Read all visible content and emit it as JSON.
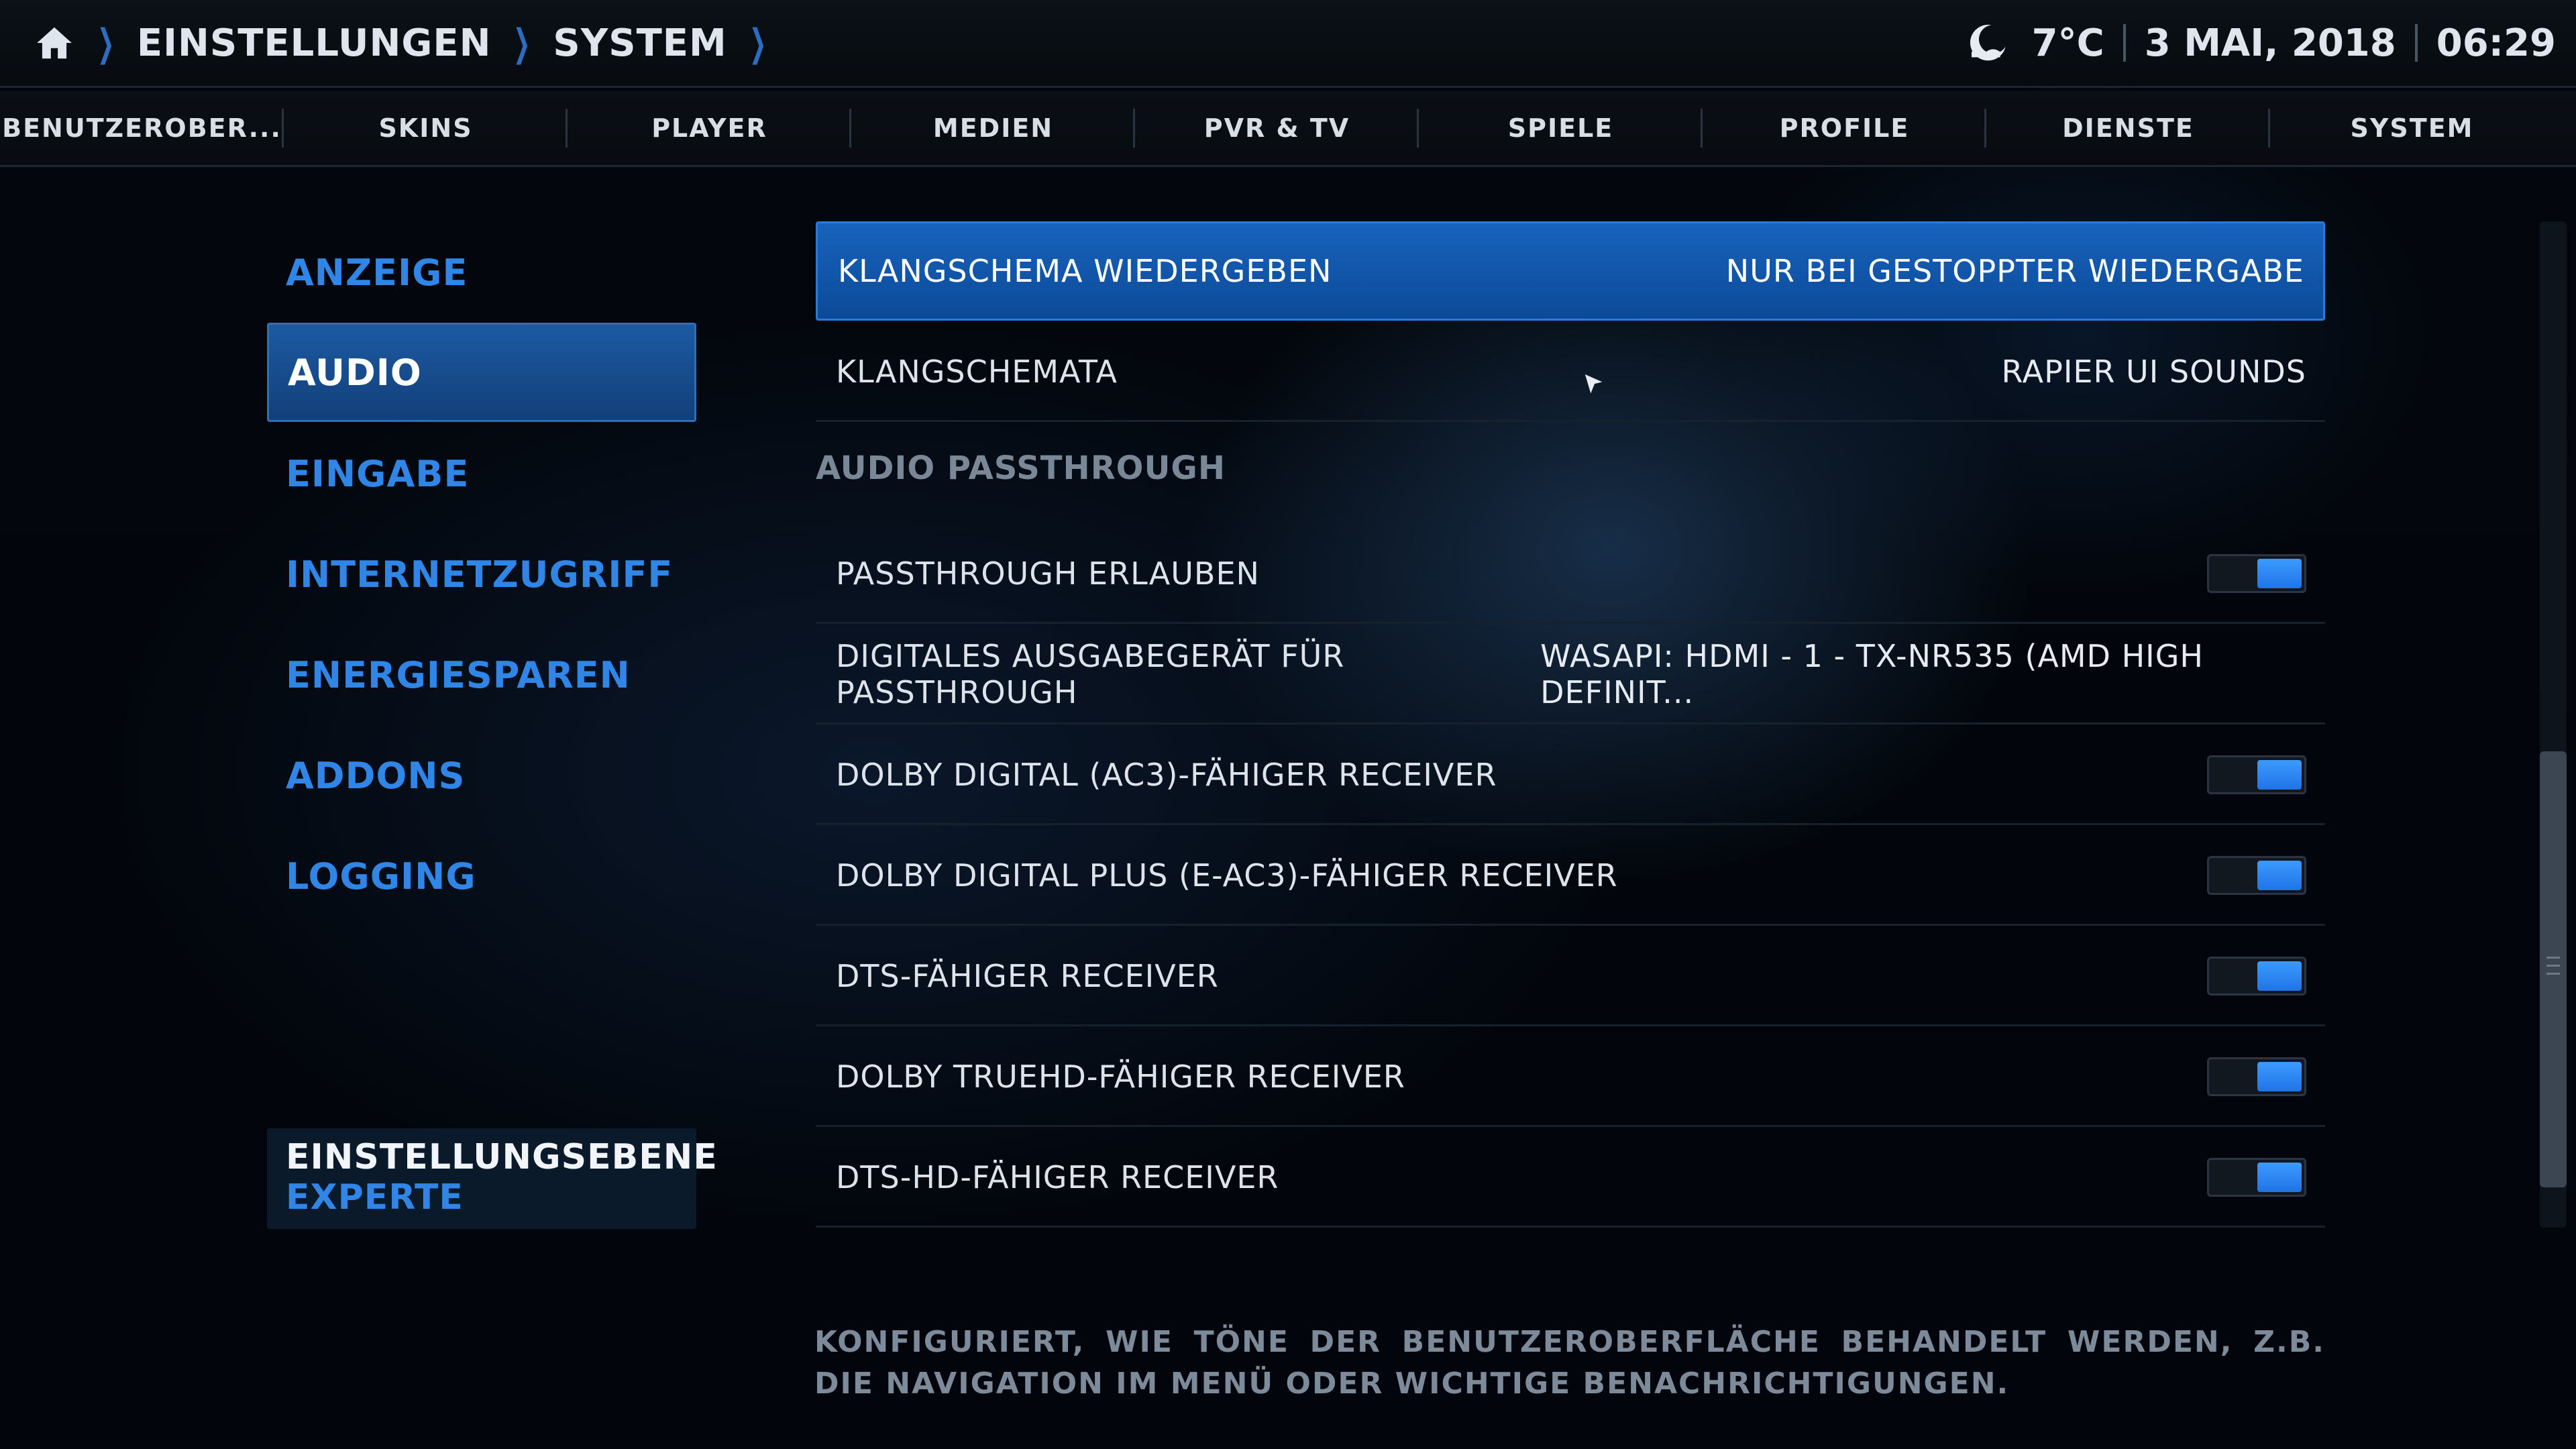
{
  "header": {
    "breadcrumbs": [
      "EINSTELLUNGEN",
      "SYSTEM"
    ],
    "weather_icon": "moon-icon",
    "temperature": "7°C",
    "date": "3 MAI, 2018",
    "time": "06:29"
  },
  "tabs": [
    "BENUTZEROBER...",
    "SKINS",
    "PLAYER",
    "MEDIEN",
    "PVR & TV",
    "SPIELE",
    "PROFILE",
    "DIENSTE",
    "SYSTEM"
  ],
  "sidebar": {
    "items": [
      {
        "label": "ANZEIGE",
        "active": false
      },
      {
        "label": "AUDIO",
        "active": true
      },
      {
        "label": "EINGABE",
        "active": false
      },
      {
        "label": "INTERNETZUGRIFF",
        "active": false
      },
      {
        "label": "ENERGIESPAREN",
        "active": false
      },
      {
        "label": "ADDONS",
        "active": false
      },
      {
        "label": "LOGGING",
        "active": false
      }
    ],
    "level_title": "EINSTELLUNGSEBENE",
    "level_value": "EXPERTE"
  },
  "settings": {
    "row_sound_scheme_playback": {
      "label": "KLANGSCHEMA WIEDERGEBEN",
      "value": "NUR BEI GESTOPPTER WIEDERGABE"
    },
    "row_sound_schemes": {
      "label": "KLANGSCHEMATA",
      "value": "RAPIER UI SOUNDS"
    },
    "section_passthrough": "AUDIO PASSTHROUGH",
    "row_allow_passthrough": {
      "label": "PASSTHROUGH ERLAUBEN",
      "enabled": true
    },
    "row_passthrough_device": {
      "label": "DIGITALES AUSGABEGERÄT FÜR PASSTHROUGH",
      "value": "WASAPI: HDMI - 1 - TX-NR535 (AMD HIGH DEFINIT..."
    },
    "row_ac3": {
      "label": "DOLBY DIGITAL (AC3)-FÄHIGER RECEIVER",
      "enabled": true
    },
    "row_eac3": {
      "label": "DOLBY DIGITAL PLUS (E-AC3)-FÄHIGER RECEIVER",
      "enabled": true
    },
    "row_dts": {
      "label": "DTS-FÄHIGER RECEIVER",
      "enabled": true
    },
    "row_truehd": {
      "label": "DOLBY TRUEHD-FÄHIGER RECEIVER",
      "enabled": true
    },
    "row_dtshd": {
      "label": "DTS-HD-FÄHIGER RECEIVER",
      "enabled": true
    }
  },
  "description": "KONFIGURIERT, WIE TÖNE DER BENUTZEROBERFLÄCHE BEHANDELT WERDEN, Z.B. DIE NAVIGATION IM MENÜ ODER WICHTIGE BENACHRICHTIGUNGEN.",
  "colors": {
    "accent": "#2f86e6",
    "focus_row": "#1763bd",
    "toggle_on": "#3c9bff"
  }
}
